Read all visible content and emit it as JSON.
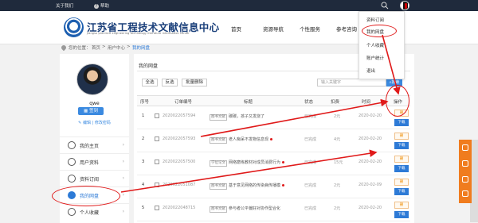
{
  "topbar": {
    "about": "关于我们",
    "help": "帮助"
  },
  "header": {
    "title": "江苏省工程技术文献信息中心",
    "subtitle": "Jiangsu province engineering technology literature information center",
    "nav": [
      "首页",
      "资源导航",
      "个性服务",
      "参考咨询"
    ]
  },
  "dropdown": {
    "items": [
      "资料订阅",
      "我的网盘",
      "个人收藏",
      "账户统计",
      "退出"
    ]
  },
  "breadcrumb": {
    "label": "您的位置：",
    "home": "首页",
    "sep1": ">",
    "center": "用户中心",
    "sep2": ">",
    "current": "我的网盘"
  },
  "sidebar": {
    "username": "qwe",
    "signin": "签到",
    "links": "✎ 编辑 | 修改密码",
    "items": [
      {
        "label": "我的主页",
        "icon": "home-icon"
      },
      {
        "label": "用户资料",
        "icon": "user-icon"
      },
      {
        "label": "资料订阅",
        "icon": "subscribe-icon"
      },
      {
        "label": "我的网盘",
        "icon": "cloud-icon",
        "active": true
      },
      {
        "label": "个人收藏",
        "icon": "heart-icon"
      }
    ]
  },
  "main": {
    "title": "我的网盘",
    "filters": [
      "全选",
      "反选",
      "批量删除"
    ],
    "search_placeholder": "输入关键字",
    "search_button": "搜索",
    "columns": [
      "序号",
      "订单编号",
      "标题",
      "状态",
      "扣费",
      "时间",
      "操作"
    ],
    "rows": [
      {
        "num": "1",
        "order": "2020022057594",
        "tag": "图书文献",
        "title": "碳碳，孩子又发烧了",
        "status": "已完成",
        "fee": "2元",
        "date": "2020-02-20",
        "dot": false
      },
      {
        "num": "2",
        "order": "2020022057593",
        "tag": "图书文献",
        "title": "老人痴呆不发物信息现",
        "status": "已完成",
        "fee": "4元",
        "date": "2020-02-20",
        "dot": true
      },
      {
        "num": "3",
        "order": "2020022057500",
        "tag": "学位论文",
        "title": "网络磨练教材对成员消费行为",
        "status": "已完成",
        "fee": "15元",
        "date": "2020-02-20",
        "dot": true
      },
      {
        "num": "4",
        "order": "2020022051087",
        "tag": "图书文献",
        "title": "基于意见网络的传染病传播模",
        "status": "已完成",
        "fee": "2元",
        "date": "2020-02-09",
        "dot": true
      },
      {
        "num": "5",
        "order": "2020022048715",
        "tag": "图书文献",
        "title": "参与者公平偏好对协作型合化",
        "status": "已完成",
        "fee": "2元",
        "date": "2020-02-20",
        "dot": false
      }
    ],
    "delete_label": "删",
    "download_label": "下载"
  },
  "colors": {
    "accent": "#2d7ad6",
    "annotation": "#e01a1a",
    "float_bar": "#f07c1e",
    "topbar": "#1f2a3c"
  }
}
